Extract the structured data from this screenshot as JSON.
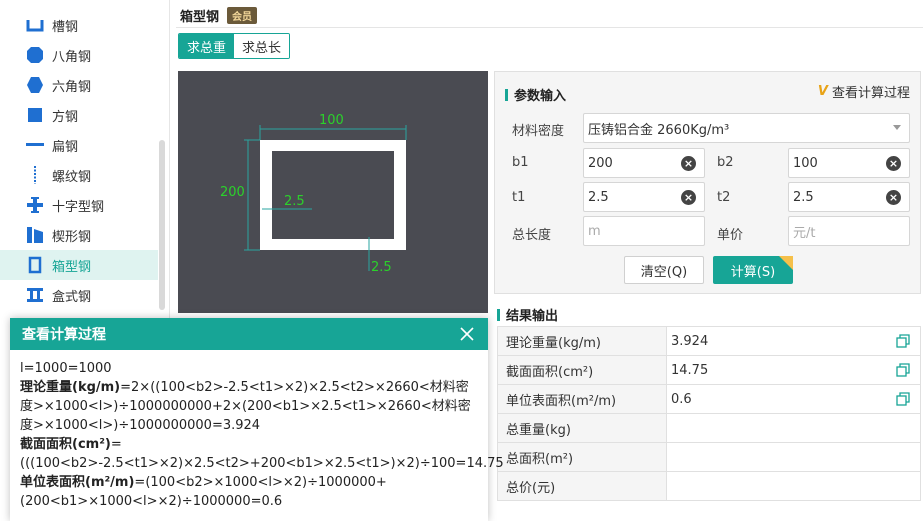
{
  "sidebar": {
    "items": [
      {
        "label": "槽钢",
        "icon": "channel-icon"
      },
      {
        "label": "八角钢",
        "icon": "octagon-icon"
      },
      {
        "label": "六角钢",
        "icon": "hexagon-icon"
      },
      {
        "label": "方钢",
        "icon": "square-icon"
      },
      {
        "label": "扁钢",
        "icon": "flat-bar-icon"
      },
      {
        "label": "螺纹钢",
        "icon": "rebar-icon"
      },
      {
        "label": "十字型钢",
        "icon": "cross-icon"
      },
      {
        "label": "楔形钢",
        "icon": "wedge-icon"
      },
      {
        "label": "箱型钢",
        "icon": "box-icon"
      },
      {
        "label": "盒式钢",
        "icon": "i-beam-icon"
      }
    ],
    "active_index": 8
  },
  "header": {
    "title": "箱型钢",
    "badge": "会员"
  },
  "tabs": [
    {
      "label": "求总重"
    },
    {
      "label": "求总长"
    }
  ],
  "diagram": {
    "width_label": "100",
    "height_label": "200",
    "t1_label": "2.5",
    "t2_label": "2.5"
  },
  "params": {
    "title": "参数输入",
    "view_process": "查看计算过程",
    "vk": "V",
    "density_label": "材料密度",
    "density_value": "压铸铝合金 2660Kg/m³",
    "b1_label": "b1",
    "b1_value": "200",
    "b2_label": "b2",
    "b2_value": "100",
    "t1_label": "t1",
    "t1_value": "2.5",
    "t2_label": "t2",
    "t2_value": "2.5",
    "length_label": "总长度",
    "length_placeholder": "m",
    "price_label": "单价",
    "price_placeholder": "元/t",
    "clear_btn": "清空(Q)",
    "calc_btn": "计算(S)"
  },
  "results": {
    "title": "结果输出",
    "rows": [
      {
        "label": "理论重量(kg/m)",
        "value": "3.924",
        "copy": true
      },
      {
        "label": "截面面积(cm²)",
        "value": "14.75",
        "copy": true
      },
      {
        "label": "单位表面积(m²/m)",
        "value": "0.6",
        "copy": true
      },
      {
        "label": "总重量(kg)",
        "value": "",
        "copy": false
      },
      {
        "label": "总面积(m²)",
        "value": "",
        "copy": false
      },
      {
        "label": "总价(元)",
        "value": "",
        "copy": false
      }
    ]
  },
  "dialog": {
    "title": "查看计算过程",
    "line1": "l=1000=1000",
    "weight_label": "理论重量(kg/m)",
    "weight_formula": "=2×((100<b2>-2.5<t1>×2)×2.5<t2>×2660<材料密度>×1000<l>)÷1000000000+2×(200<b1>×2.5<t1>×2660<材料密度>×1000<l>)÷1000000000=3.924",
    "area_label": "截面面积(cm²)",
    "area_formula": "=(((100<b2>-2.5<t1>×2)×2.5<t2>+200<b1>×2.5<t1>)×2)÷100=14.75",
    "surface_label": "单位表面积(m²/m)",
    "surface_formula": "=(100<b2>×1000<l>×2)÷1000000+(200<b1>×1000<l>×2)÷1000000=0.6"
  },
  "colors": {
    "accent": "#17a596",
    "diagram_bg": "#4a4b52",
    "dimension_green": "#2bd12b",
    "dimension_line": "#2aa5a0"
  }
}
